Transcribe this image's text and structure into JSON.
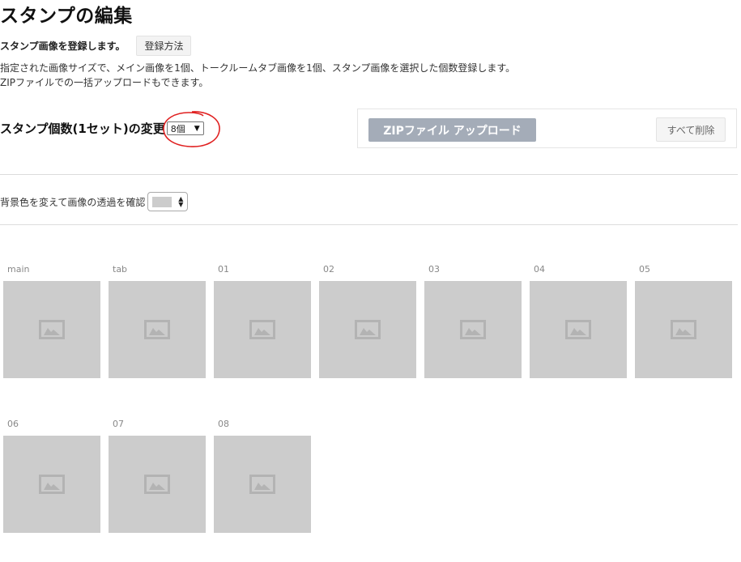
{
  "page": {
    "title": "スタンプの編集",
    "intro_text": "スタンプ画像を登録します。",
    "guide_button": "登録方法",
    "description_lines": [
      "指定された画像サイズで、メイン画像を1個、トークルームタブ画像を1個、スタンプ画像を選択した個数登録します。",
      "ZIPファイルでの一括アップロードもできます。"
    ]
  },
  "count": {
    "label": "スタンプ個数(1セット)の変更",
    "selected": "8個",
    "highlight_color": "#e02020"
  },
  "upload": {
    "zip_button": "ZIPファイル アップロード",
    "delete_all_button": "すべて削除",
    "zip_button_color": "#a4acb8"
  },
  "background": {
    "label": "背景色を変えて画像の透過を確認",
    "selected_color": "#cccccc"
  },
  "slots": {
    "row1": [
      {
        "label": "main",
        "icon": "image-placeholder-icon"
      },
      {
        "label": "tab",
        "icon": "image-placeholder-icon"
      },
      {
        "label": "01",
        "icon": "image-placeholder-icon"
      },
      {
        "label": "02",
        "icon": "image-placeholder-icon"
      },
      {
        "label": "03",
        "icon": "image-placeholder-icon"
      },
      {
        "label": "04",
        "icon": "image-placeholder-icon"
      },
      {
        "label": "05",
        "icon": "image-placeholder-icon"
      }
    ],
    "row2": [
      {
        "label": "06",
        "icon": "image-placeholder-icon"
      },
      {
        "label": "07",
        "icon": "image-placeholder-icon"
      },
      {
        "label": "08",
        "icon": "image-placeholder-icon"
      }
    ],
    "placeholder_color": "#cccccc",
    "icon_color": "#b3b3b3"
  }
}
